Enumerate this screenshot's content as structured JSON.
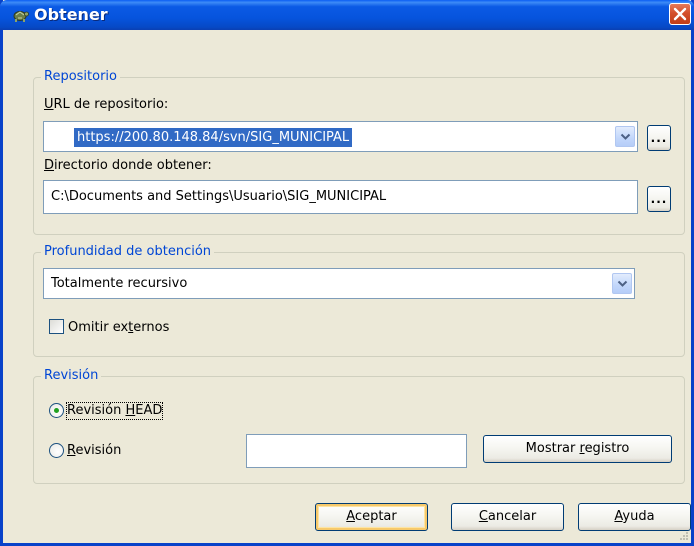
{
  "window": {
    "title": "Obtener"
  },
  "repository": {
    "legend": "Repositorio",
    "url_label_u": "U",
    "url_label_rest": "RL de repositorio:",
    "url_value": "https://200.80.148.84/svn/SIG_MUNICIPAL",
    "url_browse_label": "...",
    "dir_label_u": "D",
    "dir_label_rest": "irectorio donde obtener:",
    "dir_value": "C:\\Documents and Settings\\Usuario\\SIG_MUNICIPAL",
    "dir_browse_label": "..."
  },
  "depth": {
    "legend": "Profundidad de obtención",
    "selected": "Totalmente recursivo",
    "omit_externals_pre": "Omitir ex",
    "omit_externals_u": "t",
    "omit_externals_post": "ernos",
    "omit_externals_checked": false
  },
  "revision": {
    "legend": "Revisión",
    "head_pre": "Revisión ",
    "head_u": "H",
    "head_post": "EAD",
    "head_selected": true,
    "rev_u": "R",
    "rev_post": "evisión",
    "rev_selected": false,
    "rev_value": "",
    "show_log_pre": "Mostrar ",
    "show_log_u": "r",
    "show_log_post": "egistro"
  },
  "buttons": {
    "ok_u": "A",
    "ok_post": "ceptar",
    "cancel_u": "C",
    "cancel_post": "ancelar",
    "help_u": "A",
    "help_post": "yuda"
  },
  "colors": {
    "titlebar": "#0654dd",
    "group_legend": "#0046d5",
    "selection": "#316ac5",
    "dialog_bg": "#ece9d8"
  },
  "icons": {
    "title": "turtle-icon",
    "close": "close-icon",
    "dropdown": "chevron-down-icon"
  }
}
